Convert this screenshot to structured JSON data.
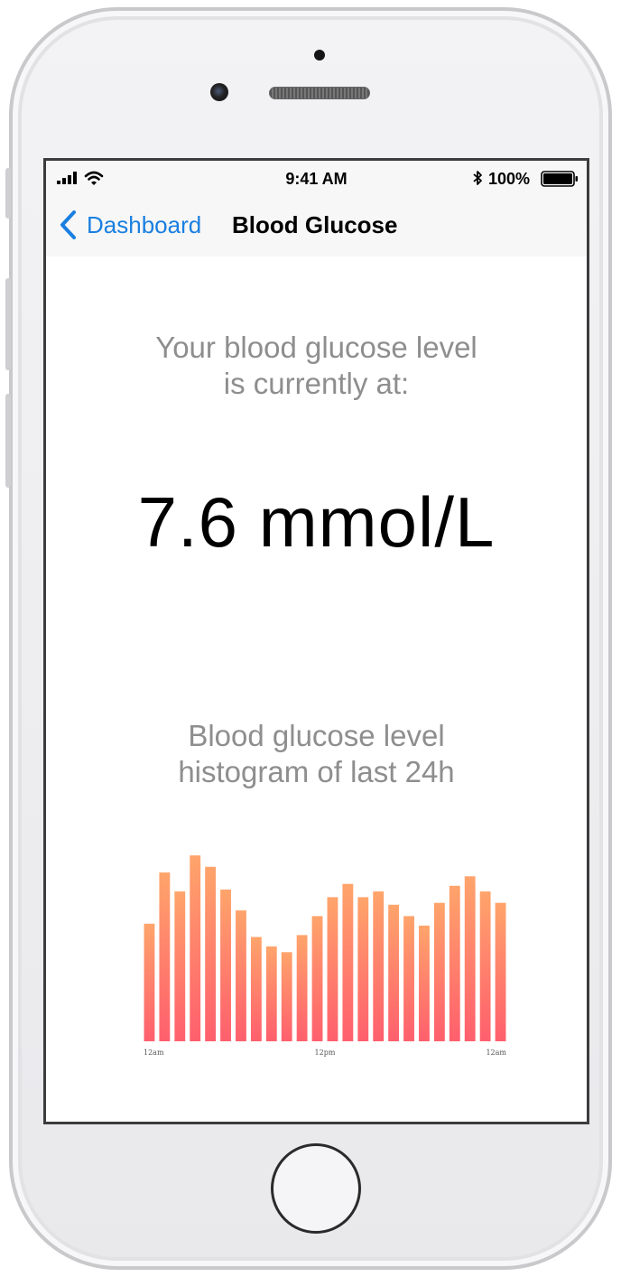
{
  "status_bar": {
    "time": "9:41 AM",
    "battery": "100%",
    "icons": [
      "signal-icon",
      "wifi-icon",
      "bluetooth-icon",
      "battery-icon"
    ]
  },
  "nav": {
    "back_label": "Dashboard",
    "title": "Blood Glucose",
    "accent_color": "#1a7fe0"
  },
  "main": {
    "current_label": "Your blood glucose level\nis currently at:",
    "current_value": "7.6 mmol/L",
    "histogram_label": "Blood glucose level\nhistogram of last 24h"
  },
  "chart_data": {
    "type": "bar",
    "categories": [
      "12am",
      "",
      "",
      "",
      "",
      "",
      "",
      "",
      "",
      "",
      "",
      "",
      "12pm",
      "",
      "",
      "",
      "",
      "",
      "",
      "",
      "",
      "",
      "",
      "",
      "12am"
    ],
    "values": [
      6.2,
      8.9,
      7.9,
      9.8,
      9.2,
      8.0,
      6.9,
      5.5,
      5.0,
      4.7,
      5.6,
      6.6,
      7.6,
      8.3,
      7.6,
      7.9,
      7.2,
      6.6,
      6.1,
      7.3,
      8.2,
      8.7,
      7.9,
      7.3
    ],
    "x_tick_labels": [
      "12am",
      "12pm",
      "12am"
    ],
    "ylim": [
      0,
      10
    ],
    "gradient_top": "#ffa46b",
    "gradient_bottom": "#ff5f6d",
    "grid": false
  }
}
